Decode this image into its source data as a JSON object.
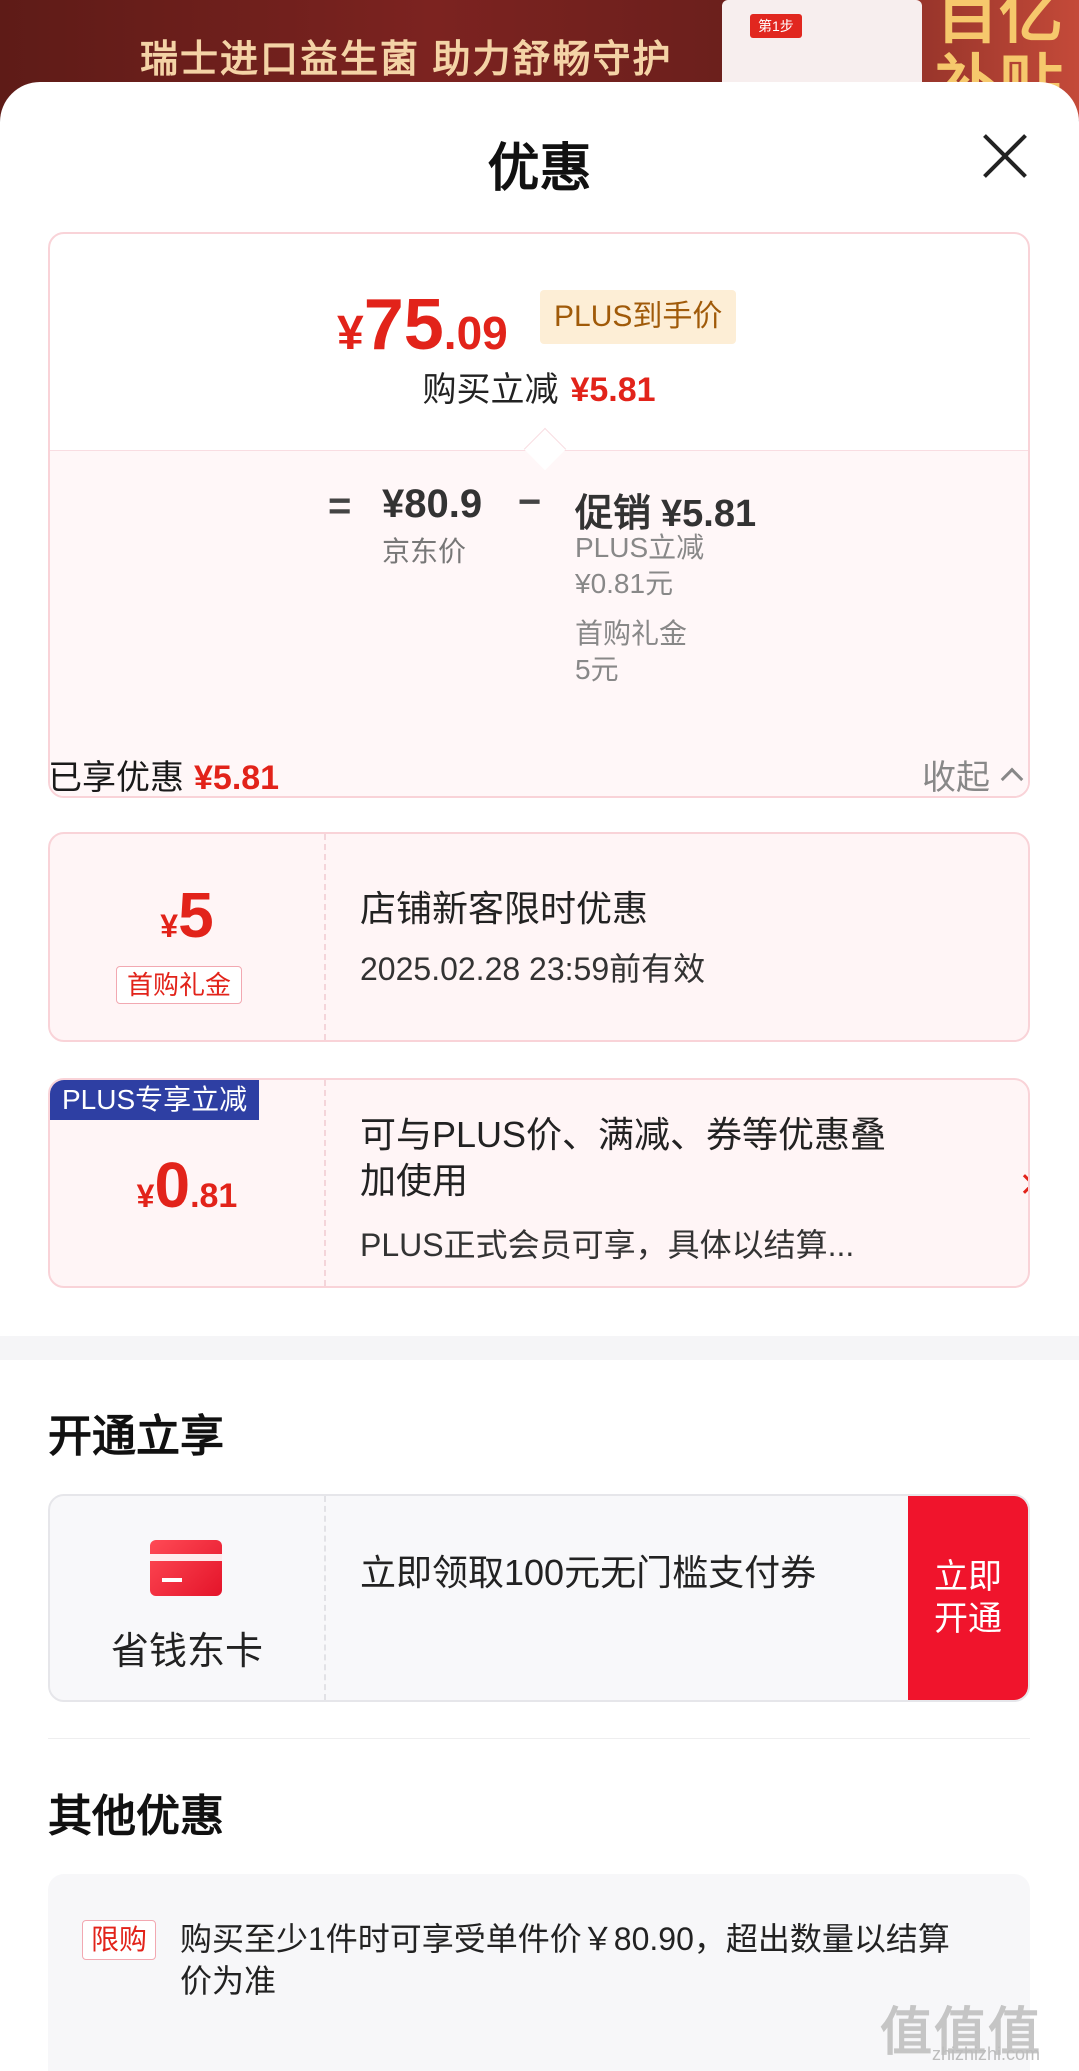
{
  "banner": {
    "tagline": "瑞士进口益生菌 助力舒畅守护",
    "tag": "第1步",
    "big_text": "百亿补贴"
  },
  "sheet": {
    "title": "优惠"
  },
  "price": {
    "symbol": "¥",
    "int": "75",
    "dec": ".09",
    "plus_tag": "PLUS到手价",
    "instant_label": "购买立减",
    "instant_value": "¥5.81",
    "equals": "=",
    "jd_price": "¥80.9",
    "jd_label": "京东价",
    "minus": "−",
    "promo_label": "促销",
    "promo_value": "¥5.81",
    "sub1_label": "PLUS立减",
    "sub1_value": "¥0.81元",
    "sub2_label": "首购礼金",
    "sub2_value": "5元"
  },
  "enjoyed": {
    "label": "已享优惠",
    "value": "¥5.81",
    "collapse": "收起"
  },
  "coupons": [
    {
      "symbol": "¥",
      "int": "5",
      "dec": "",
      "badge": "首购礼金",
      "title": "店铺新客限时优惠",
      "desc": "2025.02.28 23:59前有效"
    },
    {
      "tag": "PLUS专享立减",
      "symbol": "¥",
      "int": "0",
      "dec": ".81",
      "title": "可与PLUS价、满减、券等优惠叠加使用",
      "desc": "PLUS正式会员可享，具体以结算..."
    }
  ],
  "open_section": {
    "title": "开通立享",
    "card_name": "省钱东卡",
    "desc": "立即领取100元无门槛支付券",
    "button": "立即开通"
  },
  "other": {
    "title": "其他优惠",
    "tag": "限购",
    "text": "购买至少1件时可享受单件价￥80.90，超出数量以结算价为准"
  },
  "watermark": {
    "text": "值值值",
    "sub": "zhizhizhi.com"
  },
  "colors": {
    "accent": "#e2231a",
    "plus_blue": "#2e3fa3",
    "button_red": "#f0142c"
  }
}
